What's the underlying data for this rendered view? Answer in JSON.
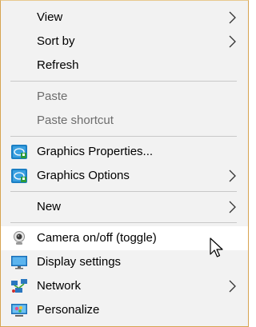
{
  "menu": {
    "items": [
      {
        "label": "View",
        "enabled": true,
        "submenu": true
      },
      {
        "label": "Sort by",
        "enabled": true,
        "submenu": true
      },
      {
        "label": "Refresh",
        "enabled": true,
        "submenu": false
      },
      {
        "label": "Paste",
        "enabled": false,
        "submenu": false
      },
      {
        "label": "Paste shortcut",
        "enabled": false,
        "submenu": false
      },
      {
        "label": "Graphics Properties...",
        "enabled": true,
        "submenu": false,
        "icon": "intel-graphics-icon"
      },
      {
        "label": "Graphics Options",
        "enabled": true,
        "submenu": true,
        "icon": "intel-graphics-icon"
      },
      {
        "label": "New",
        "enabled": true,
        "submenu": true
      },
      {
        "label": "Camera on/off (toggle)",
        "enabled": true,
        "submenu": false,
        "icon": "webcam-icon",
        "highlighted": true
      },
      {
        "label": "Display settings",
        "enabled": true,
        "submenu": false,
        "icon": "monitor-icon"
      },
      {
        "label": "Network",
        "enabled": true,
        "submenu": true,
        "icon": "network-icon"
      },
      {
        "label": "Personalize",
        "enabled": true,
        "submenu": false,
        "icon": "personalize-icon"
      }
    ]
  },
  "colors": {
    "menu_background": "#f2f2f2",
    "highlight_background": "#ffffff",
    "disabled_text": "#6d6d6d",
    "separator": "#c8c8c8",
    "border": "#d7a451"
  }
}
